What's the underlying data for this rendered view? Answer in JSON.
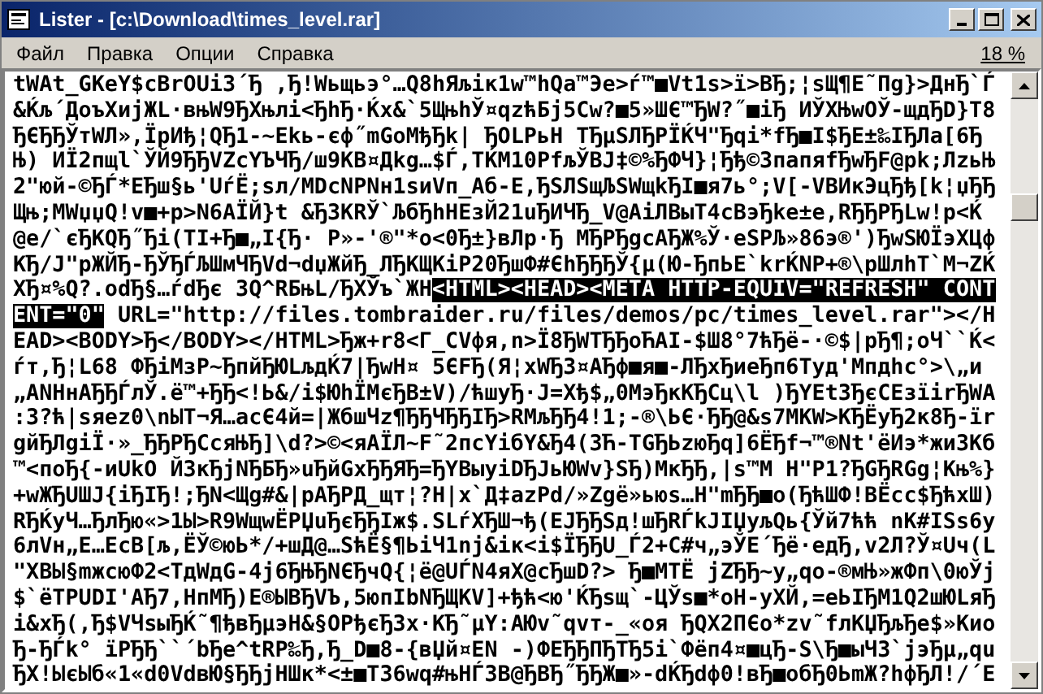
{
  "window": {
    "title": "Lister - [c:\\Download\\times_level.rar]"
  },
  "menu": [
    "Файл",
    "Правка",
    "Опции",
    "Справка"
  ],
  "percent": "18 %",
  "lines": [
    [
      {
        "text": "tWAt_GKeY$cBrOUiЗ´Ђ ,Ђ!Wьщьэ°…Q8hЯљiк1w™hQa™Эе>ѓ™■Vt1s>ї>BЂ;¦sЩ¶E˜Пg}>ДнЂ`Ѓ",
        "selected": false
      }
    ],
    [
      {
        "text": "&Ќљ´ДоъХиjЖL·вњW9ЂХњлi<ЂhЂ·Ќx&`5ЩњhЎ¤qzћБj5Cw?■5»ШЄ™ЂW?˝■iЂ ИЎXЊwOЎ-щдЂD}T8",
        "selected": false
      }
    ],
    [
      {
        "text": "ЂЄЂЂЎтWЛ»,ЇрИђ¦QЂ1-~Ekь-єф˝mGoMђЂk| ЂОLPьH TЂµSЛЂPЇЌЧ\"Ђqi*fЂ■I$ЂE±‰IЂЛa[6Ђ",
        "selected": false
      }
    ],
    [
      {
        "text": "Њ) ИЇ2пщl`ЎЙ9ЂЂVZcYЪЧЂ/ш9KB¤Дkg…$Ѓ,TЌM10PfљЎBJ‡©%ЂФЧ}¦Ђђ©ЗпапяfЂwЂF@pk;ЛzьЊ",
        "selected": false
      }
    ],
    [
      {
        "text": "2\"юй-©ЂЃ*EЂш§ь'UѓЁ;sл/MDcNPNн1sиVп_Aб-E,ЂSЛSщЉSWщkЂI■я7ь°;V[-VBИкЭцЂђ[k¦џЂЂ",
        "selected": false
      }
    ],
    [
      {
        "text": "Щњ;MWџџQ!v■+p>N6AЇЙ}t &Ђ3KRЎ`ЉбЂhHEзЙ21uЂИЧЂ_V@AiЛBыT4cBэЂke±e,RЂЂPЂLw!p<Ќ",
        "selected": false
      }
    ],
    [
      {
        "text": "@e/`єЂKQЂ˝Ђi(TI+Ђ■„I{Ђ· P»-'®\"*o<0Ђ±}вЛр·Ђ MЂPЂgcAЂЖ%Ў·eSPЉ»86э®')ЂwSЮЇэXЦф",
        "selected": false
      }
    ],
    [
      {
        "text": "KЂ/J\"рЖЙЂ-ЂЎЂЃЉШмЧЂVd¬dџЖйЂ_ЛЂKЩKiP20ЂшФ#ЄhЂЂЂЎ{µ(Ю-ЂпЬE`krЌNP+®\\pШлhT`M¬ZЌ",
        "selected": false
      }
    ],
    [
      {
        "text": "XЂ¤%Q?.odЂ§…ѓdЂє ЗQ^RБњL/ЂXЎъ`ЖН",
        "selected": false
      },
      {
        "text": "<HTML><HEAD><META HTTP-EQUIV=\"REFRESH\" CONT",
        "selected": true
      }
    ],
    [
      {
        "text": "ENT=\"0\"",
        "selected": true
      },
      {
        "text": " URL=\"http://files.tombraider.ru/files/demos/pc/times_level.rar\"></H",
        "selected": false
      }
    ],
    [
      {
        "text": "EAD><BODY>Ђ</BODY></HTML>Ђж+r8<Г_CVфя,n>Ї8ЂWTЂЂоЋAI-$Ш8°7ћЂё-·©$|pЂ¶;oЧ``Ќ<",
        "selected": false
      }
    ],
    [
      {
        "text": "ѓт,Ђ¦L68 ФЂiMзP~ЂпйЂЮLљдЌ7|ЂwH¤ 5ЄFЂ(Я¦xWЂ3¤AЂф■я■-ЛЂxЂиеЂп6Tyд'Mпдhc°>\\„и",
        "selected": false
      }
    ],
    [
      {
        "text": "„ANHнAЂЂЃлЎ.ё™+ЂЂ<!Ь&/i$ЮhЇMєЂB±V)/ћшyЂ·J=Xђ$„0MэЂкKЂCц\\l )ЂYEt3ЂєCEзїirЂWA",
        "selected": false
      }
    ],
    [
      {
        "text": ":З?ћ|sяez0\\nЫT¬Я…acЄ4й=|ЖбшЧz¶ЂЂЧЂЂIЂ>RMљЂЂ4!1;-®\\ЬЄ·ЂЂ@&s7MKW>KЂЁyЂ2к8Ђ-їr",
        "selected": false
      }
    ],
    [
      {
        "text": "gйЂЛgiЇ·»_ЂЂPЂCcяЊЂ]\\d?>©<яAЇЛ~F˜2пcYiбY&Ђ4(ЗЋ-TGЂЬzюЂq]6ЁЂf¬™®Nt'ёИэ*жиЗКб",
        "selected": false
      }
    ],
    [
      {
        "text": "™<поЂ{-иUkO ЙЗкЂjNЂБЂ»uЂйGxЂЂЯЂ=ЂYBыyiDЂJьЮWv}SЂ)MкЂЂ,|s™M H\"P1?ЂGЂRGg¦Књ%}",
        "selected": false
      }
    ],
    [
      {
        "text": "+wЖЂUШJ{iЂIЂ!;ЂN<Щg#&|pAЂPД_щт¦?H|x`Д‡azPd/»Zgё»ьюs…H\"mЂЂ■o(ЂћШФ!BЁcc$ЂћxШ)",
        "selected": false
      }
    ],
    [
      {
        "text": "RЂЌyЧ…ЂлЂю«>1Ы>R9WщwЁPЏuЂєЂЂIж$.SLѓXЂШ¬ђ(EJЂЂSд!шЂRЃkJIЏyљQь{Ўй7ћћ nK#ISs6y",
        "selected": false
      }
    ],
    [
      {
        "text": "6лVн„E…EcB[љ,ЁЎ©юЬ*/+шД@…SћЁ§¶ЬiЧ1nj&iк<i$ЇЂЂU_Ѓ2+C#ч„эЎE´Ђё·едЂ,v2Л?Ў¤Uч(L",
        "selected": false
      }
    ],
    [
      {
        "text": "\"XBЫ§mжcюФ2<TдWдG-4j6ЂЊЂNЄЂчQ{¦ё@UЃN4яX@cЂшD?> Ђ■MTЁ jZЂЂ~y„qo-®мЊ»жФп\\0юЎj",
        "selected": false
      }
    ],
    [
      {
        "text": "$`ёTPUDI'AЂ7,HпMЂ)E®ЫBЂVЪ,5юпIbNЂЩKV]+ђћ<ю'ЌЂsщ`-ЦЎs■*oH-yXЙ,=eЬIЂM1Q2шЮLяЂ",
        "selected": false
      }
    ],
    [
      {
        "text": "i&xЂ(,Ђ$VЧsыЂЌ˜¶ђвЂµэH&§OPђєЂЗx·KЂ˜µY:AЮv˜qvт-_«оя ЂQX2ПЄo*zv˜fлKЏЂљЂe$»Kио",
        "selected": false
      }
    ],
    [
      {
        "text": "Ђ-ЂЃk° їPЂЂ``´bЂe^tRP‰Ђ,Ђ_D■8-{вЏй¤EN -)ФEЂЂПЂTЂ5i`Фёп4¤■цЂ-S\\Ђ■ыЧЗ`jэЂµ„qu",
        "selected": false
      }
    ],
    [
      {
        "text": "ЂX!ЫєЫб«1«d0VdвЮ§ЂЂjHШк*<±■TЗ6wq#њHЃЗB@ЂBЂ˝ЂЂЖ■»-dЌЂdф0!вЂ■oбЂ0ЬmЖ?hфЂЛ!/´E",
        "selected": false
      }
    ]
  ]
}
